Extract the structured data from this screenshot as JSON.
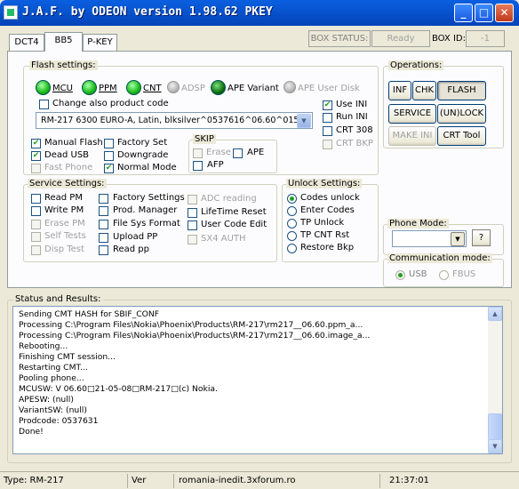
{
  "window": {
    "title": "J.A.F. by ODEON version 1.98.62 PKEY"
  },
  "tabs": [
    "DCT4",
    "BB5",
    "P-KEY"
  ],
  "box": {
    "status_label": "BOX STATUS:",
    "status_value": "Ready",
    "id_label": "BOX ID:",
    "id_value": "-1"
  },
  "flash_settings": {
    "title": "Flash settings:",
    "leds": [
      {
        "label": "MCU",
        "state": "on"
      },
      {
        "label": "PPM",
        "state": "on"
      },
      {
        "label": "CNT",
        "state": "on"
      },
      {
        "label": "ADSP",
        "state": "disabled"
      },
      {
        "label": "APE Variant",
        "state": "on-dark"
      },
      {
        "label": "APE User Disk",
        "state": "disabled"
      }
    ],
    "change_product_code": "Change also product code",
    "product_select": "RM-217 6300 EURO-A, Latin, blksilver^0537616^06.60^015",
    "ini_checks": [
      {
        "label": "Use INI",
        "checked": true,
        "enabled": true
      },
      {
        "label": "Run INI",
        "checked": false,
        "enabled": true
      },
      {
        "label": "CRT 308",
        "checked": false,
        "enabled": true
      },
      {
        "label": "CRT BKP",
        "checked": false,
        "enabled": false
      }
    ],
    "options": [
      {
        "label": "Manual Flash",
        "checked": true,
        "enabled": true
      },
      {
        "label": "Factory Set",
        "checked": false,
        "enabled": true
      },
      {
        "label": "Dead USB",
        "checked": true,
        "enabled": true
      },
      {
        "label": "Downgrade",
        "checked": false,
        "enabled": true
      },
      {
        "label": "Fast Phone",
        "checked": false,
        "enabled": false
      },
      {
        "label": "Normal Mode",
        "checked": true,
        "enabled": true
      }
    ],
    "skip": {
      "title": "SKIP",
      "erase": "Erase",
      "ape": "APE",
      "afp": "AFP"
    }
  },
  "operations": {
    "title": "Operations:",
    "buttons": [
      "INF",
      "CHK",
      "FLASH",
      "SERVICE",
      "(UN)LOCK",
      "MAKE INI",
      "CRT Tool"
    ]
  },
  "service_settings": {
    "title": "Service Settings:",
    "col1": [
      {
        "label": "Read PM",
        "enabled": true
      },
      {
        "label": "Write PM",
        "enabled": true
      },
      {
        "label": "Erase PM",
        "enabled": false
      },
      {
        "label": "Self Tests",
        "enabled": false
      },
      {
        "label": "Disp Test",
        "enabled": false
      }
    ],
    "col2": [
      {
        "label": "Factory Settings",
        "enabled": true
      },
      {
        "label": "Prod. Manager",
        "enabled": true
      },
      {
        "label": "File Sys Format",
        "enabled": true
      },
      {
        "label": "Upload PP",
        "enabled": true
      },
      {
        "label": "Read pp",
        "enabled": true
      }
    ],
    "col3": [
      {
        "label": "ADC reading",
        "enabled": false
      },
      {
        "label": "LifeTime Reset",
        "enabled": true
      },
      {
        "label": "User Code Edit",
        "enabled": true
      },
      {
        "label": "SX4 AUTH",
        "enabled": false
      }
    ]
  },
  "unlock_settings": {
    "title": "Unlock Settings:",
    "options": [
      "Codes unlock",
      "Enter Codes",
      "TP Unlock",
      "TP CNT Rst",
      "Restore Bkp"
    ],
    "selected": 0
  },
  "phone_mode": {
    "title": "Phone Mode:",
    "value": "",
    "help": "?"
  },
  "comm_mode": {
    "title": "Communication mode:",
    "usb": "USB",
    "fbus": "FBUS"
  },
  "status": {
    "title": "Status and Results:",
    "lines": [
      "Sending CMT HASH for SBIF_CONF",
      "Processing C:\\Program Files\\Nokia\\Phoenix\\Products\\RM-217\\rm217__06.60.ppm_a...",
      "Processing C:\\Program Files\\Nokia\\Phoenix\\Products\\RM-217\\rm217__06.60.image_a...",
      "Rebooting...",
      "Finishing CMT session...",
      "Restarting CMT...",
      "Pooling phone...",
      "MCUSW: V 06.60□21-05-08□RM-217□(c) Nokia.",
      "APESW: (null)",
      "VariantSW: (null)",
      "Prodcode: 0537631",
      "Done!"
    ]
  },
  "statusbar": {
    "type": "Type: RM-217",
    "ver": "Ver",
    "site": "romania-inedit.3xforum.ro",
    "time": "21:37:01"
  },
  "colors": {
    "titlebar": "#0855d0",
    "face": "#ece9d8",
    "led_on": "#1fc01f"
  }
}
